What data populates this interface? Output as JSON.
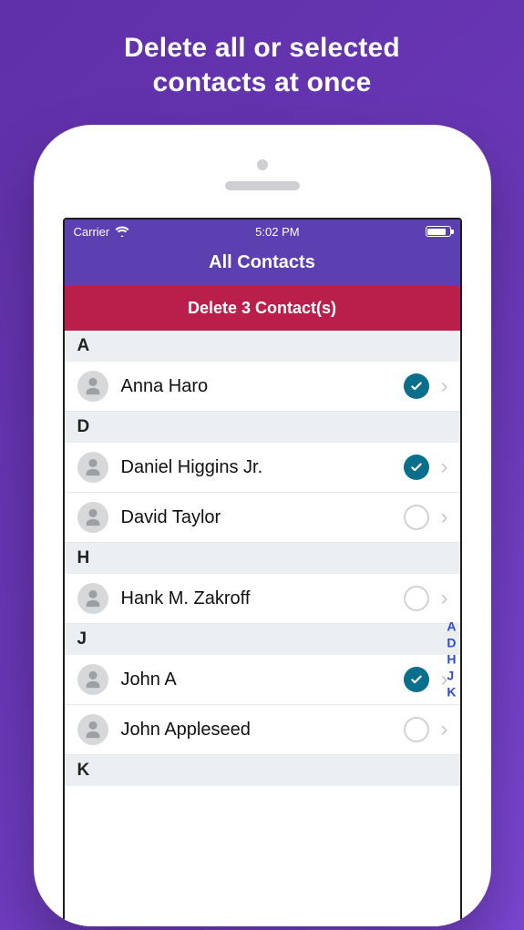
{
  "promo": {
    "line1": "Delete all or selected",
    "line2": "contacts at once"
  },
  "status_bar": {
    "carrier": "Carrier",
    "time": "5:02 PM"
  },
  "nav": {
    "title": "All Contacts"
  },
  "delete_button": {
    "label": "Delete 3 Contact(s)"
  },
  "sections": [
    {
      "letter": "A",
      "rows": [
        {
          "name": "Anna Haro",
          "selected": true
        }
      ]
    },
    {
      "letter": "D",
      "rows": [
        {
          "name": "Daniel Higgins Jr.",
          "selected": true
        },
        {
          "name": "David Taylor",
          "selected": false
        }
      ]
    },
    {
      "letter": "H",
      "rows": [
        {
          "name": "Hank M. Zakroff",
          "selected": false
        }
      ]
    },
    {
      "letter": "J",
      "rows": [
        {
          "name": "John A",
          "selected": true
        },
        {
          "name": "John Appleseed",
          "selected": false
        }
      ]
    },
    {
      "letter": "K",
      "rows": []
    }
  ],
  "index_letters": [
    "A",
    "D",
    "H",
    "J",
    "K"
  ]
}
